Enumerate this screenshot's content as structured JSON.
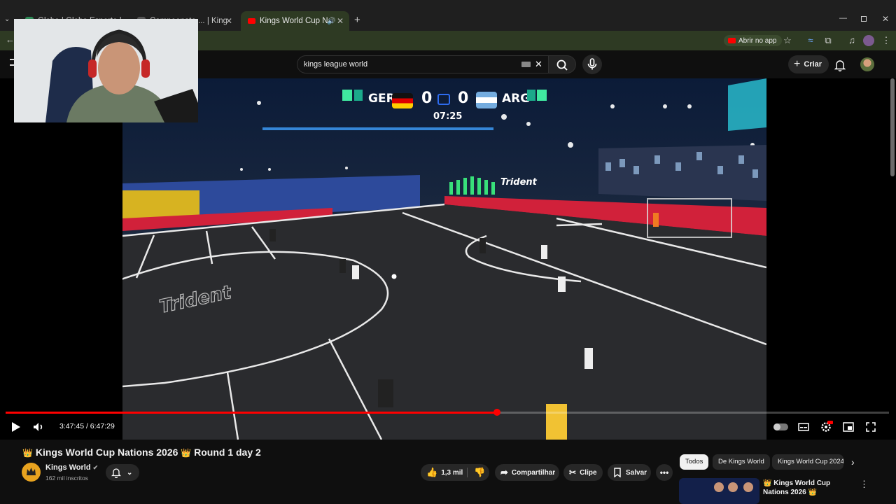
{
  "browser": {
    "tabs": [
      {
        "label": "Globo | Globo Esporte | ..."
      },
      {
        "label": "Campeonato ... | Kings W"
      },
      {
        "label": "Kings World Cup Nation",
        "active": true
      }
    ],
    "abrir_no_app": "Abrir no app",
    "icons": [
      "tab-list-icon",
      "back-icon",
      "star-icon",
      "extensions-icon",
      "minimize-icon",
      "restore-icon",
      "close-icon"
    ]
  },
  "youtube": {
    "search": {
      "value": "kings league world"
    },
    "criar_label": "Criar"
  },
  "video": {
    "scoreboard": {
      "home_team": "GER",
      "home_score": "0",
      "away_team": "ARG",
      "away_score": "0",
      "clock": "07:25"
    },
    "board_text": "Trident",
    "time_current": "3:47:45",
    "time_total": "6:47:29",
    "time_display": "3:47:45 / 6:47:29",
    "progress_fraction": 0.556
  },
  "meta": {
    "title_prefix_emoji": "👑",
    "title": "Kings World Cup Nations 2026",
    "title_suffix": "Round 1 day 2",
    "channel_name": "Kings World",
    "subscribers": "162 mil inscritos",
    "likes": "1,3 mil",
    "share_label": "Compartilhar",
    "clip_label": "Clipe",
    "save_label": "Salvar"
  },
  "chips": [
    {
      "label": "Todos",
      "selected": true
    },
    {
      "label": "De Kings World"
    },
    {
      "label": "Kings World Cup 2024"
    }
  ],
  "recommendation": {
    "title": "👑 Kings World Cup Nations 2026 👑"
  },
  "colors": {
    "accent_red": "#ff0000",
    "tab_active": "#2e3a23",
    "background": "#0f0f0f"
  }
}
